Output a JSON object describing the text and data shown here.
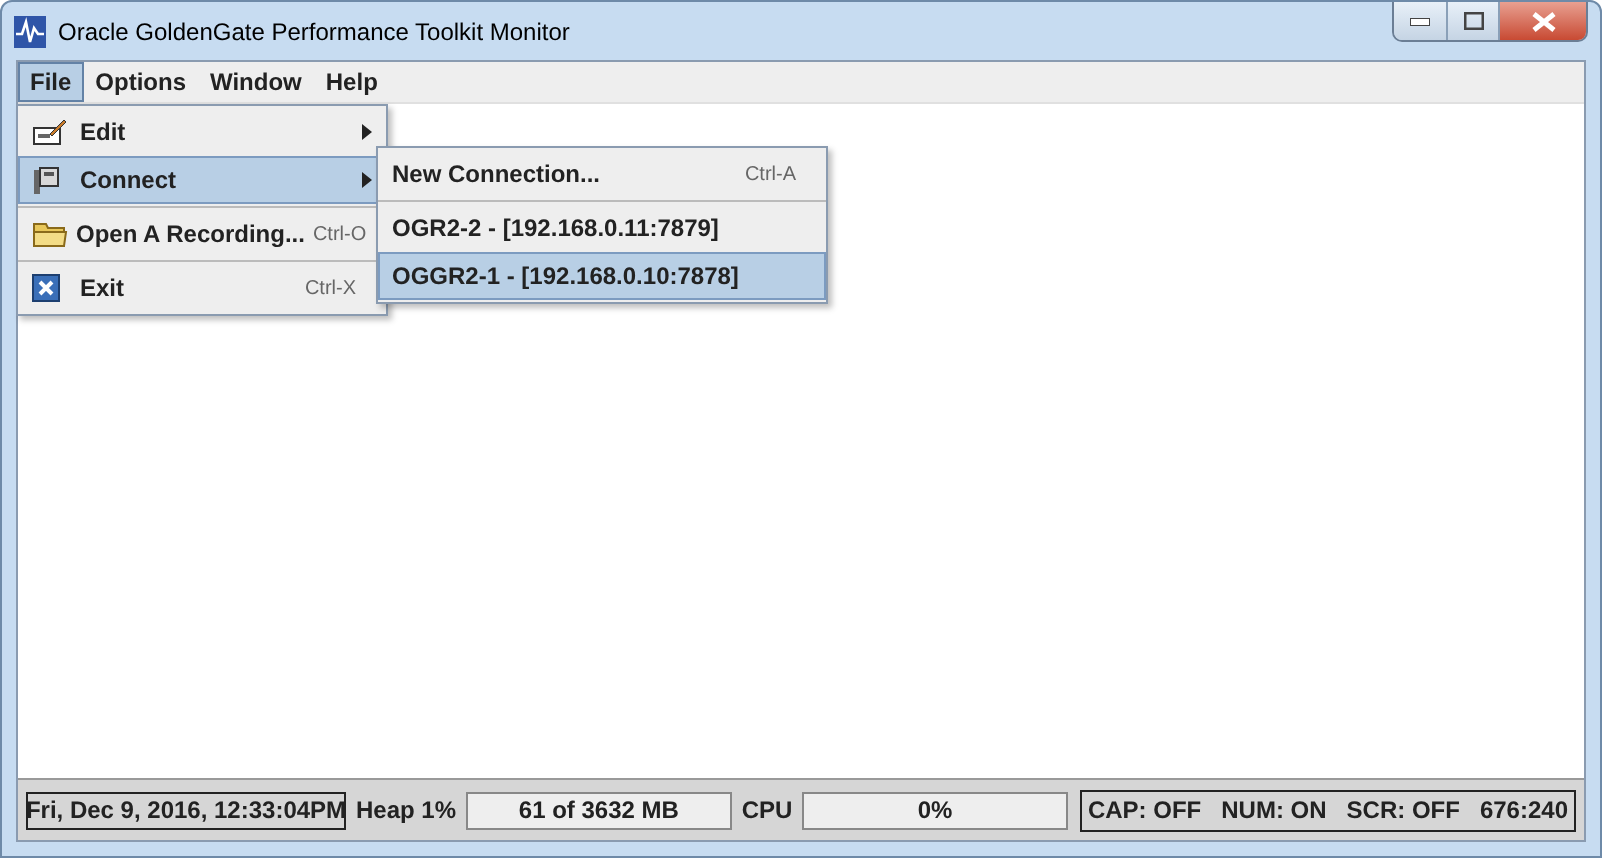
{
  "window": {
    "title": "Oracle GoldenGate Performance Toolkit Monitor"
  },
  "menu_bar": [
    {
      "label": "File",
      "selected": true
    },
    {
      "label": "Options",
      "selected": false
    },
    {
      "label": "Window",
      "selected": false
    },
    {
      "label": "Help",
      "selected": false
    }
  ],
  "file_menu": [
    {
      "kind": "item",
      "label": "Edit",
      "submenu": true,
      "selected": false
    },
    {
      "kind": "item",
      "label": "Connect",
      "submenu": true,
      "selected": true
    },
    {
      "kind": "separator"
    },
    {
      "kind": "item",
      "label": "Open A Recording...",
      "shortcut": "Ctrl-O",
      "submenu": false,
      "selected": false
    },
    {
      "kind": "separator"
    },
    {
      "kind": "item",
      "label": "Exit",
      "shortcut": "Ctrl-X",
      "submenu": false,
      "selected": false
    }
  ],
  "connect_menu": [
    {
      "kind": "item",
      "label": "New Connection...",
      "shortcut": "Ctrl-A",
      "selected": false
    },
    {
      "kind": "separator"
    },
    {
      "kind": "item",
      "label": "OGR2-2 - [192.168.0.11:7879]",
      "selected": false
    },
    {
      "kind": "item",
      "label": "OGGR2-1 - [192.168.0.10:7878]",
      "selected": true
    }
  ],
  "status_bar": {
    "datetime": "Fri, Dec 9, 2016, 12:33:04PM",
    "heap_label": "Heap 1%",
    "heap_value": "61 of 3632 MB",
    "cpu_label": "CPU",
    "cpu_value": "0%",
    "indicators": [
      "CAP: OFF",
      "NUM: ON",
      "SCR: OFF",
      "676:240"
    ]
  }
}
